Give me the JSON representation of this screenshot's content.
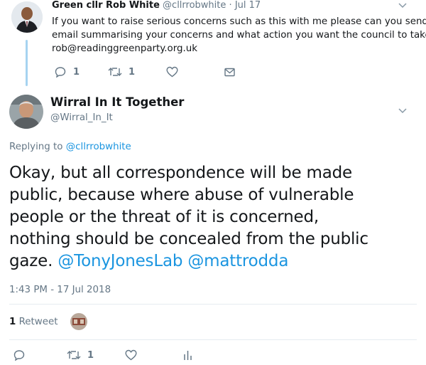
{
  "parent_tweet": {
    "display_name": "Green cllr Rob White",
    "handle": "@cllrrobwhite",
    "separator": "·",
    "date": "Jul 17",
    "text_line1": "If you want to raise serious concerns such as this with me please can you send me",
    "text_line2": "email summarising your concerns and what action you want the council to take",
    "text_line3": "rob@readinggreenparty.org.uk",
    "actions": {
      "reply_count": "1",
      "retweet_count": "1"
    }
  },
  "main_tweet": {
    "display_name": "Wirral In It Together",
    "handle": "@Wirral_In_It",
    "replying_prefix": "Replying to",
    "replying_handle": "@cllrrobwhite",
    "text_line1": "Okay, but all correspondence will be made",
    "text_line2": "public, because where abuse of vulnerable",
    "text_line3": "people or the threat of it is concerned,",
    "text_line4": "nothing should be concealed from the public",
    "text_line5_plain": "gaze.",
    "mention1": "@TonyJonesLab",
    "mention2": "@mattrodda",
    "timestamp": "1:43 PM - 17 Jul 2018",
    "stats": {
      "retweet_count": "1",
      "retweet_label": "Retweet"
    },
    "actions": {
      "retweet_count": "1"
    }
  },
  "colors": {
    "link": "#1b95e0",
    "muted": "#657786",
    "thread_line": "#a6d3f0"
  }
}
